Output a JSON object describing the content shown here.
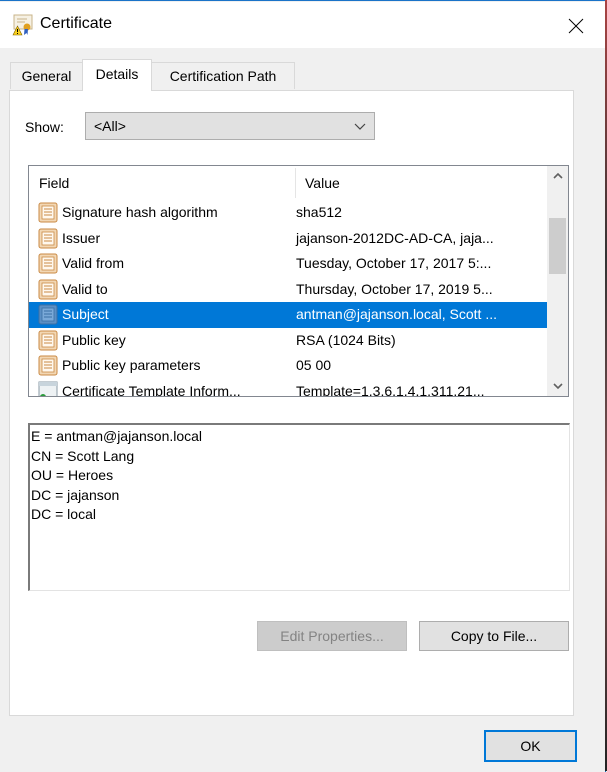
{
  "window": {
    "title": "Certificate",
    "title_icon": "certificate-warning-icon",
    "close_icon": "close-icon"
  },
  "tabs": [
    {
      "label": "General",
      "active": false
    },
    {
      "label": "Details",
      "active": true
    },
    {
      "label": "Certification Path",
      "active": false
    }
  ],
  "show": {
    "label": "Show:",
    "selected": "<All>"
  },
  "list": {
    "columns": [
      "Field",
      "Value"
    ],
    "rows": [
      {
        "field": "Signature hash algorithm",
        "value": "sha512",
        "selected": false,
        "icon": "property-icon"
      },
      {
        "field": "Issuer",
        "value": "jajanson-2012DC-AD-CA, jaja...",
        "selected": false,
        "icon": "property-icon"
      },
      {
        "field": "Valid from",
        "value": "Tuesday, October 17, 2017 5:...",
        "selected": false,
        "icon": "property-icon"
      },
      {
        "field": "Valid to",
        "value": "Thursday, October 17, 2019 5...",
        "selected": false,
        "icon": "property-icon"
      },
      {
        "field": "Subject",
        "value": "antman@jajanson.local, Scott ...",
        "selected": true,
        "icon": "property-icon"
      },
      {
        "field": "Public key",
        "value": "RSA (1024 Bits)",
        "selected": false,
        "icon": "property-icon"
      },
      {
        "field": "Public key parameters",
        "value": "05 00",
        "selected": false,
        "icon": "property-icon"
      },
      {
        "field": "Certificate Template Inform...",
        "value": "Template=1.3.6.1.4.1.311.21...",
        "selected": false,
        "icon": "extension-icon"
      }
    ]
  },
  "detail": {
    "lines": [
      "E = antman@jajanson.local",
      "CN = Scott Lang",
      "OU = Heroes",
      "DC = jajanson",
      "DC = local"
    ]
  },
  "buttons": {
    "edit_properties": "Edit Properties...",
    "copy_to_file": "Copy to File...",
    "ok": "OK"
  },
  "colors": {
    "selection": "#0078d7",
    "focus_border": "#0078d7",
    "window_border": "#1a73c8"
  }
}
